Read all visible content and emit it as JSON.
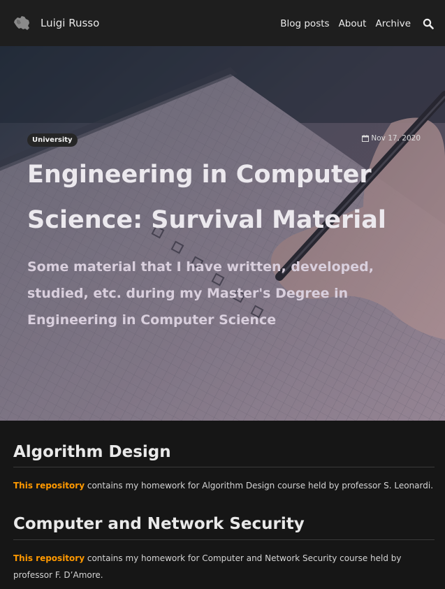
{
  "site": {
    "brand_name": "Luigi Russo",
    "logo_icon": "italy-map-icon"
  },
  "nav": {
    "items": [
      {
        "label": "Blog posts"
      },
      {
        "label": "About"
      },
      {
        "label": "Archive"
      }
    ],
    "search_icon": "search-icon"
  },
  "hero": {
    "tag": "University",
    "date": "Nov 17, 2020",
    "date_icon": "calendar-icon",
    "title": "Engineering in Computer Science: Survival Material",
    "subtitle": "Some material that I have written, developed, studied, etc. during my Master's Degree in Engineering in Computer Science"
  },
  "sections": [
    {
      "title": "Algorithm Design",
      "link_text": "This repository",
      "text": " contains my homework for Algorithm Design course held by professor S. Leonardi."
    },
    {
      "title": "Computer and Network Security",
      "link_text": "This repository",
      "text": " contains my homework for Computer and Network Security course held by professor F. D’Amore."
    }
  ],
  "colors": {
    "navbar_bg": "#1e1e1e",
    "page_bg": "#161616",
    "link": "#ff9900"
  }
}
